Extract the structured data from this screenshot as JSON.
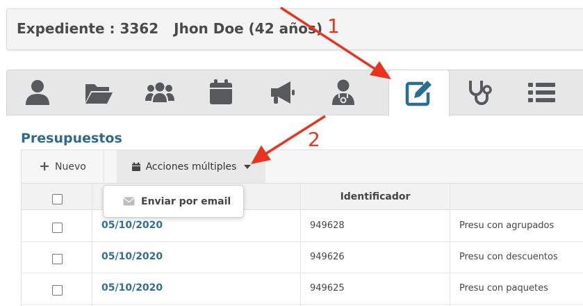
{
  "header": {
    "record_label": "Expediente : 3362",
    "patient": "Jhon Doe (42 años)"
  },
  "tabs": [
    {
      "icon": "user-icon",
      "active": false
    },
    {
      "icon": "folder-open-icon",
      "active": false
    },
    {
      "icon": "users-icon",
      "active": false
    },
    {
      "icon": "calendar-icon",
      "active": false
    },
    {
      "icon": "megaphone-icon",
      "active": false
    },
    {
      "icon": "doctor-icon",
      "active": false
    },
    {
      "icon": "edit-icon",
      "active": true
    },
    {
      "icon": "stethoscope-icon",
      "active": false
    },
    {
      "icon": "list-icon",
      "active": false
    }
  ],
  "section": {
    "title": "Presupuestos"
  },
  "toolbar": {
    "new_label": "Nuevo",
    "multi_actions_label": "Acciones múltiples"
  },
  "dropdown": {
    "email_label": "Enviar por email"
  },
  "table": {
    "columns": [
      "",
      "",
      "Identificador",
      ""
    ],
    "rows": [
      {
        "date": "05/10/2020",
        "id": "949628",
        "desc": "Presu con agrupados"
      },
      {
        "date": "05/10/2020",
        "id": "949626",
        "desc": "Presu con descuentos"
      },
      {
        "date": "05/10/2020",
        "id": "949625",
        "desc": "Presu con paquetes"
      }
    ]
  },
  "annotations": {
    "one": "1",
    "two": "2"
  },
  "colors": {
    "accent": "#2e6b8a",
    "link": "#2f6f93",
    "icon": "#58595b",
    "active_icon": "#2a6e92",
    "annotation": "#e8331f"
  }
}
